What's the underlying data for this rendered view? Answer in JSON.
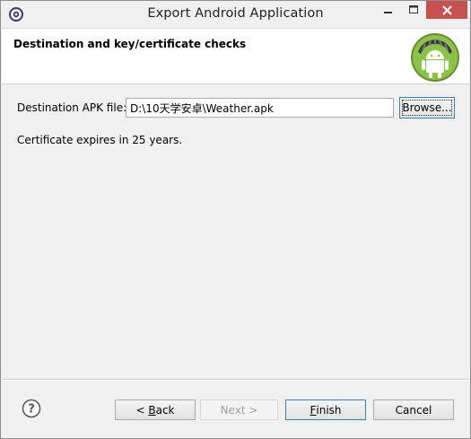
{
  "window": {
    "title": "Export Android Application"
  },
  "header": {
    "title": "Destination and key/certificate checks",
    "logo_icon": "android-robot-icon"
  },
  "form": {
    "destination_label": "Destination APK file:",
    "destination_value": "D:\\10天学安卓\\Weather.apk",
    "browse_label": "Browse...",
    "certificate_message": "Certificate expires in 25 years."
  },
  "footer": {
    "back_prefix": "< ",
    "back_key": "B",
    "back_rest": "ack",
    "next_label": "Next >",
    "finish_key": "F",
    "finish_rest": "inish",
    "cancel_label": "Cancel"
  },
  "colors": {
    "close_button": "#c75050",
    "android_green": "#8bc34a",
    "focus_border": "#3c7fb1"
  }
}
